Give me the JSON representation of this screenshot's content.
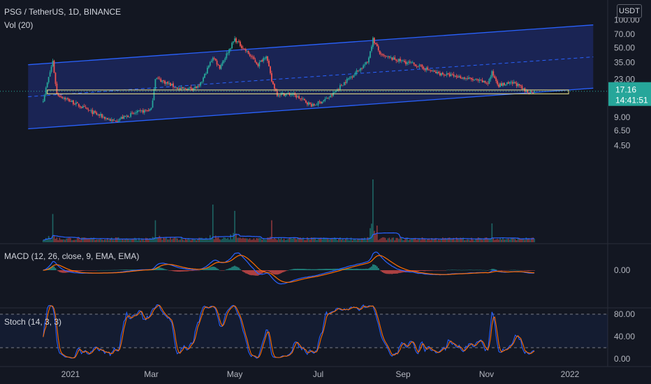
{
  "header": {
    "title": "PSG / TetherUS, 1D, BINANCE",
    "volume_label": "Vol (20)",
    "currency_button": "USDT"
  },
  "price_badge": {
    "price": "17.16",
    "countdown": "14:41:51"
  },
  "panels": {
    "macd_label": "MACD (12, 26, close, 9, EMA, EMA)",
    "stoch_label": "Stoch (14, 3, 3)"
  },
  "colors": {
    "background": "#131722",
    "up": "#26a69a",
    "down": "#ef5350",
    "channel_line": "#2962ff",
    "channel_fill": "#1e2a66",
    "highlight_box": "#f0e68c",
    "price_badge": "#26a69a",
    "macd_line": "#2962ff",
    "signal_line": "#ff6d00",
    "stoch_k": "#2962ff",
    "stoch_d": "#ff6d00"
  },
  "chart_data": {
    "type": "candlestick",
    "symbol": "PSG / TetherUS",
    "timeframe": "1D",
    "exchange": "BINANCE",
    "price_axis_ticks": [
      "100.00",
      "70.00",
      "50.00",
      "35.00",
      "23.00",
      "9.00",
      "6.50",
      "4.50"
    ],
    "macd_axis_ticks": [
      "0.00"
    ],
    "stoch_axis_ticks": [
      "80.00",
      "40.00",
      "0.00"
    ],
    "x_tick_labels": [
      "2021",
      "Mar",
      "May",
      "Jul",
      "Sep",
      "Nov",
      "2022"
    ],
    "last_price": 17.16,
    "price_anchors": [
      {
        "date": "2020-12-12",
        "price": 14
      },
      {
        "date": "2020-12-19",
        "price": 36
      },
      {
        "date": "2020-12-22",
        "price": 16
      },
      {
        "date": "2021-01-15",
        "price": 10.5
      },
      {
        "date": "2021-02-01",
        "price": 8.2
      },
      {
        "date": "2021-02-17",
        "price": 10
      },
      {
        "date": "2021-03-01",
        "price": 11
      },
      {
        "date": "2021-03-04",
        "price": 24
      },
      {
        "date": "2021-03-22",
        "price": 18
      },
      {
        "date": "2021-04-05",
        "price": 19
      },
      {
        "date": "2021-04-15",
        "price": 40
      },
      {
        "date": "2021-04-20",
        "price": 31
      },
      {
        "date": "2021-05-01",
        "price": 62
      },
      {
        "date": "2021-05-10",
        "price": 45
      },
      {
        "date": "2021-05-18",
        "price": 33
      },
      {
        "date": "2021-05-24",
        "price": 42
      },
      {
        "date": "2021-05-28",
        "price": 22
      },
      {
        "date": "2021-06-01",
        "price": 16
      },
      {
        "date": "2021-06-12",
        "price": 16
      },
      {
        "date": "2021-06-27",
        "price": 12
      },
      {
        "date": "2021-07-10",
        "price": 15
      },
      {
        "date": "2021-07-18",
        "price": 20
      },
      {
        "date": "2021-07-28",
        "price": 27
      },
      {
        "date": "2021-08-06",
        "price": 35
      },
      {
        "date": "2021-08-10",
        "price": 62
      },
      {
        "date": "2021-08-16",
        "price": 41
      },
      {
        "date": "2021-08-31",
        "price": 36
      },
      {
        "date": "2021-09-10",
        "price": 33
      },
      {
        "date": "2021-09-25",
        "price": 27
      },
      {
        "date": "2021-10-15",
        "price": 24
      },
      {
        "date": "2021-11-02",
        "price": 21
      },
      {
        "date": "2021-11-05",
        "price": 27
      },
      {
        "date": "2021-11-10",
        "price": 20
      },
      {
        "date": "2021-11-22",
        "price": 21
      },
      {
        "date": "2021-11-29",
        "price": 17.2
      },
      {
        "date": "2021-12-02",
        "price": 16.9
      },
      {
        "date": "2021-12-06",
        "price": 17.16
      }
    ],
    "volume_spikes": [
      {
        "date": "2020-12-19",
        "level": 0.45
      },
      {
        "date": "2021-03-04",
        "level": 0.35
      },
      {
        "date": "2021-04-15",
        "level": 0.6
      },
      {
        "date": "2021-05-01",
        "level": 0.5
      },
      {
        "date": "2021-05-28",
        "level": 0.35
      },
      {
        "date": "2021-08-10",
        "level": 1.0
      },
      {
        "date": "2021-11-05",
        "level": 0.3
      }
    ],
    "volume_ma_label": "Vol (20)",
    "channel": {
      "upper": [
        {
          "date": "2020-12-01",
          "price": 33
        },
        {
          "date": "2022-01-18",
          "price": 88
        }
      ],
      "lower": [
        {
          "date": "2020-12-01",
          "price": 6.8
        },
        {
          "date": "2022-01-18",
          "price": 18.5
        }
      ],
      "mid": [
        {
          "date": "2020-12-01",
          "price": 15
        },
        {
          "date": "2022-01-18",
          "price": 40
        }
      ]
    },
    "horizontal_zone": {
      "start": "2020-12-15",
      "end": "2021-12-31",
      "top": 17.7,
      "bottom": 16.1
    },
    "macd_panel": {
      "label": "MACD (12, 26, close, 9, EMA, EMA)",
      "zero": 0
    },
    "stoch_panel": {
      "label": "Stoch (14, 3, 3)",
      "upper_band": 80,
      "lower_band": 20,
      "range": [
        0,
        100
      ]
    }
  }
}
